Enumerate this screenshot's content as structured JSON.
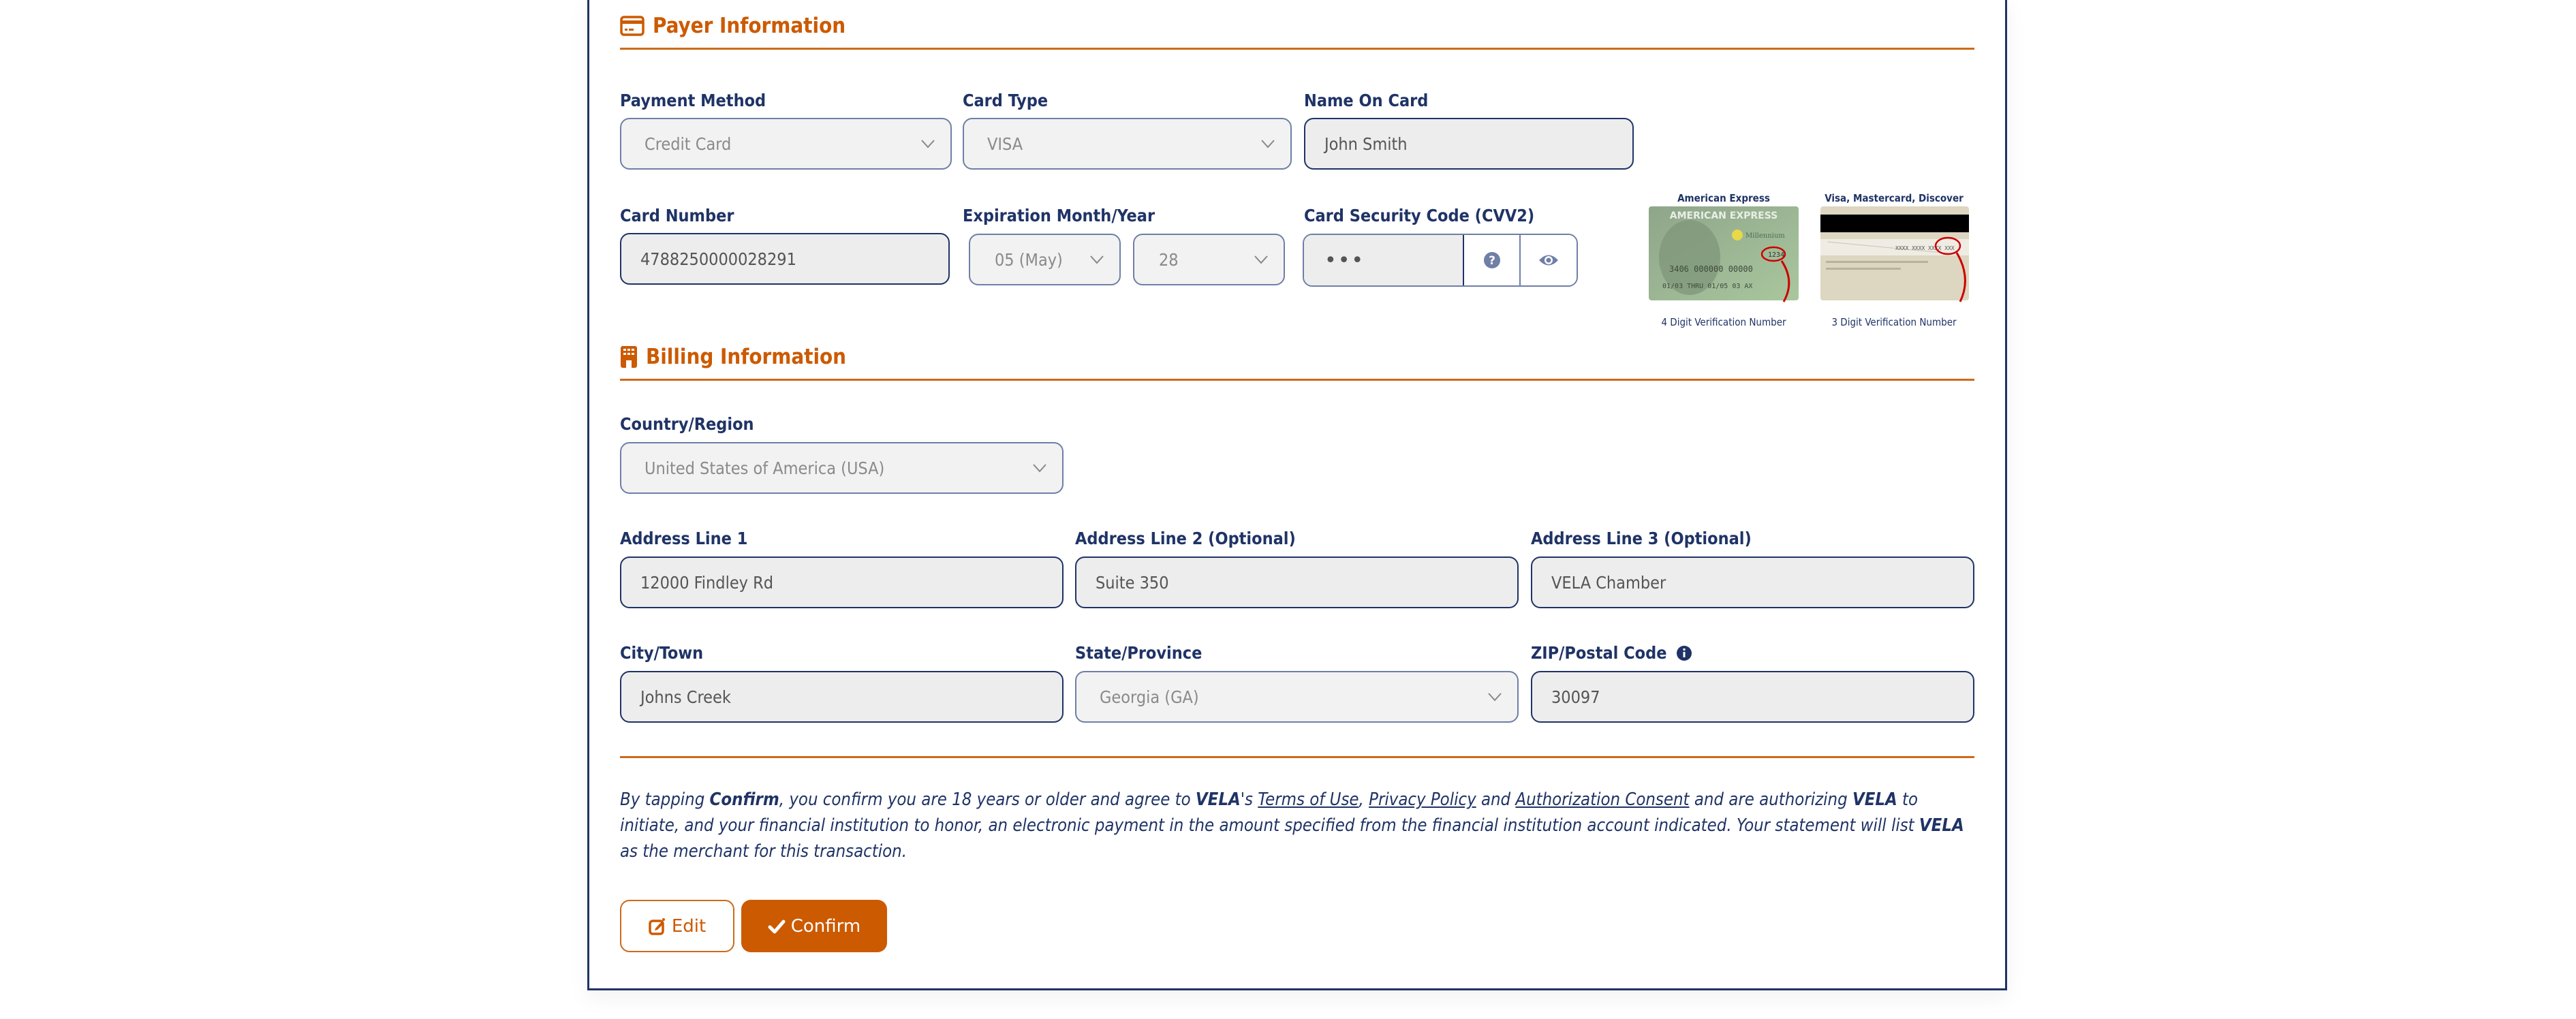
{
  "payer": {
    "title": "Payer Information",
    "icon": "credit-card-icon",
    "payment_method": {
      "label": "Payment Method",
      "value": "Credit Card"
    },
    "card_type": {
      "label": "Card Type",
      "value": "VISA"
    },
    "name_on_card": {
      "label": "Name On Card",
      "value": "John Smith"
    },
    "card_number": {
      "label": "Card Number",
      "value": "4788250000028291"
    },
    "expiration": {
      "label": "Expiration Month/Year",
      "month": "05 (May)",
      "year": "28"
    },
    "cvv": {
      "label": "Card Security Code (CVV2)",
      "value": "•••",
      "help_icon": "question-circle-icon",
      "toggle_icon": "eye-icon"
    },
    "cvv_help": {
      "amex": {
        "caption": "American Express",
        "footer": "4 Digit Verification Number",
        "sample_digits": "1234"
      },
      "others": {
        "caption": "Visa, Mastercard, Discover",
        "footer": "3 Digit Verification Number"
      }
    }
  },
  "billing": {
    "title": "Billing Information",
    "icon": "building-icon",
    "country": {
      "label": "Country/Region",
      "value": "United States of America (USA)"
    },
    "address1": {
      "label": "Address Line 1",
      "value": "12000 Findley Rd"
    },
    "address2": {
      "label": "Address Line 2 (Optional)",
      "value": "Suite 350"
    },
    "address3": {
      "label": "Address Line 3 (Optional)",
      "value": "VELA Chamber"
    },
    "city": {
      "label": "City/Town",
      "value": "Johns Creek"
    },
    "state": {
      "label": "State/Province",
      "value": "Georgia (GA)"
    },
    "zip": {
      "label": "ZIP/Postal Code",
      "value": "30097",
      "info_icon": "info-circle-icon"
    }
  },
  "consent": {
    "p1": "By tapping ",
    "confirm_word": "Confirm",
    "p2": ", you confirm you are 18 years or older and agree to ",
    "brand": "VELA",
    "p3": "'s ",
    "terms_link": "Terms of Use",
    "p4": ", ",
    "privacy_link": "Privacy Policy",
    "p5": " and ",
    "auth_link": "Authorization Consent",
    "p6": " and are authorizing ",
    "p7": " to initiate, and your financial institution to honor, an electronic payment in the amount specified from the financial institution account indicated. Your statement will list ",
    "p8": " as the merchant for this transaction."
  },
  "actions": {
    "edit_label": "Edit",
    "confirm_label": "Confirm"
  },
  "colors": {
    "accent": "#cc5a00",
    "text": "#1f3366",
    "field_bg": "#ededed"
  }
}
